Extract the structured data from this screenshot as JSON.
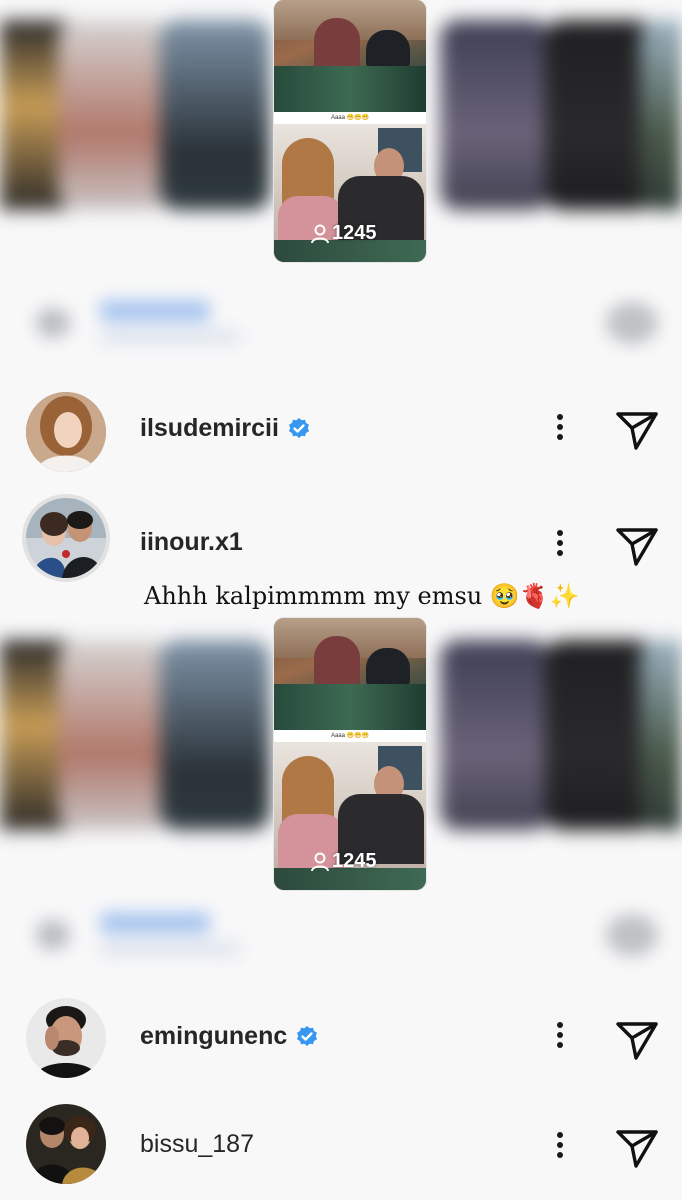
{
  "stories": [
    {
      "viewers": "1245",
      "caption": "Aaaa 😁😁😁"
    },
    {
      "viewers": "1245",
      "caption": "Aaaa 😁😁😁"
    }
  ],
  "users": [
    {
      "username": "ilsudemircii",
      "verified": true
    },
    {
      "username": "iinour.x1",
      "verified": false,
      "comment": "Ahhh kalpimmmm my emsu 🥹🫀✨"
    },
    {
      "username": "emingunenc",
      "verified": true
    },
    {
      "username": "bissu_187",
      "verified": false
    }
  ],
  "icons": {
    "more": "three-dots-vertical-icon",
    "send": "paper-plane-icon",
    "verified": "verified-badge-icon",
    "viewers": "person-icon"
  },
  "colors": {
    "verified_blue": "#3897f0",
    "text": "#262626"
  }
}
